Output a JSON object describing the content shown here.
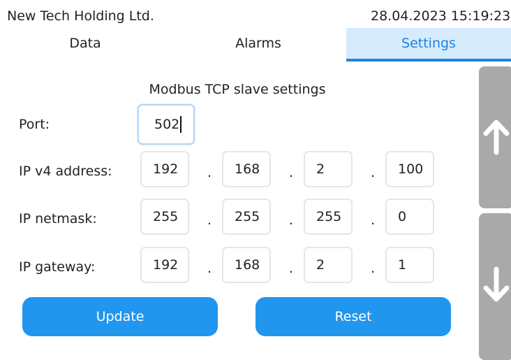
{
  "header": {
    "company": "New Tech Holding Ltd.",
    "datetime": "28.04.2023 15:19:23"
  },
  "tabs": [
    {
      "label": "Data",
      "active": false
    },
    {
      "label": "Alarms",
      "active": false
    },
    {
      "label": "Settings",
      "active": true
    }
  ],
  "form": {
    "title": "Modbus TCP slave settings",
    "port": {
      "label": "Port:",
      "value": "502"
    },
    "ip_address": {
      "label": "IP v4 address:",
      "octets": [
        "192",
        "168",
        "2",
        "100"
      ]
    },
    "netmask": {
      "label": "IP netmask:",
      "octets": [
        "255",
        "255",
        "255",
        "0"
      ]
    },
    "gateway": {
      "label": "IP gateway:",
      "octets": [
        "192",
        "168",
        "2",
        "1"
      ]
    },
    "separator": "."
  },
  "buttons": {
    "update": "Update",
    "reset": "Reset"
  },
  "scroll": {
    "up_icon": "arrow-up-icon",
    "down_icon": "arrow-down-icon"
  },
  "colors": {
    "accent": "#2196ef",
    "active_tab_bg": "#d6ebfc",
    "active_tab_text": "#1f82e0",
    "scroll_button": "#a9a9a9"
  }
}
